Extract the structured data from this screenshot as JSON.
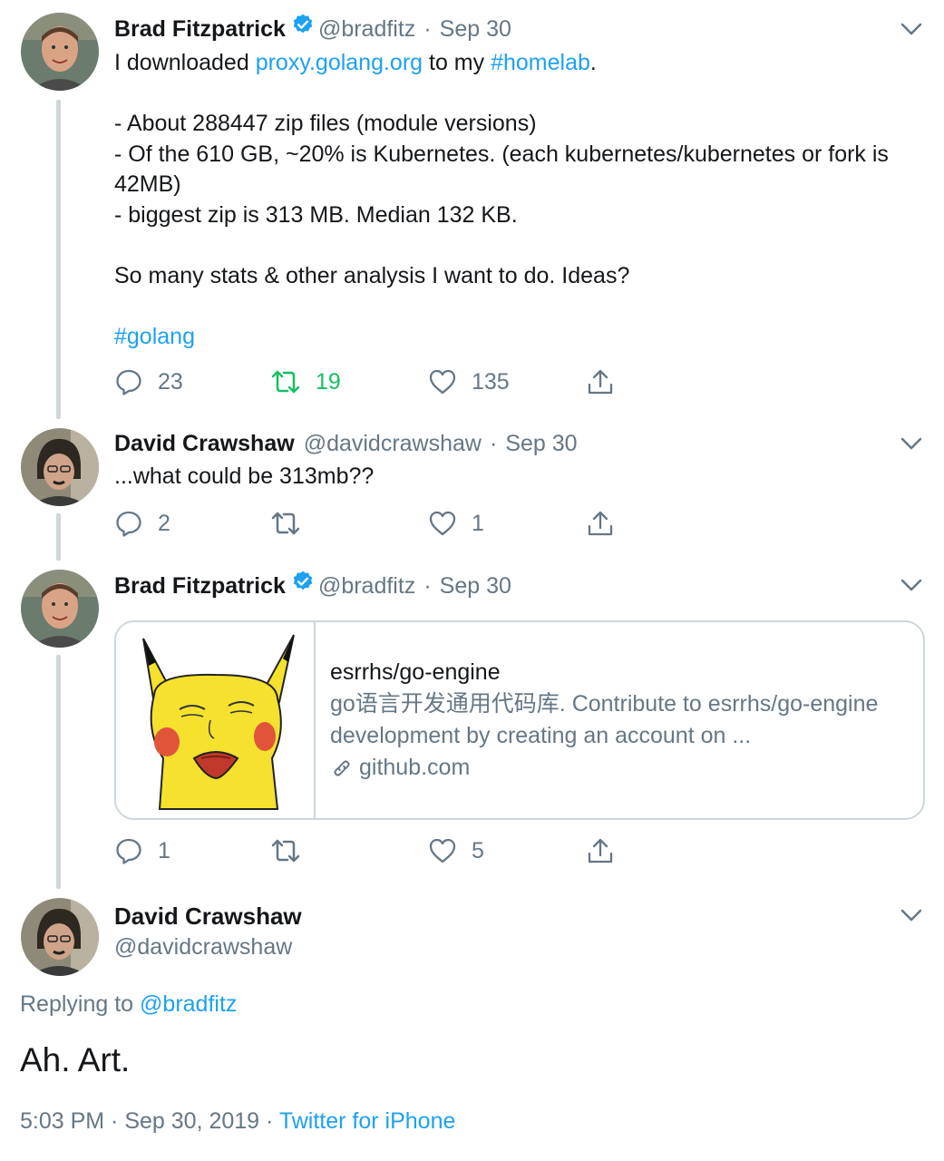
{
  "tweets": [
    {
      "name": "Brad Fitzpatrick",
      "handle": "@bradfitz",
      "dot": "·",
      "date": "Sep 30",
      "verified": true,
      "text": {
        "t1": "I downloaded ",
        "link1": "proxy.golang.org",
        "t2": " to my ",
        "hashtag1": "#homelab",
        "t3": ".",
        "line1": "- About 288447 zip files (module versions)",
        "line2": "- Of the 610 GB, ~20% is Kubernetes. (each kubernetes/kubernetes or fork is 42MB)",
        "line3": "- biggest zip is 313 MB. Median 132 KB.",
        "line4": "So many stats & other analysis I want to do. Ideas?",
        "hashtag2": "#golang"
      },
      "replies": "23",
      "retweets": "19",
      "likes": "135"
    },
    {
      "name": "David Crawshaw",
      "handle": "@davidcrawshaw",
      "dot": "·",
      "date": "Sep 30",
      "text": "...what could be 313mb??",
      "replies": "2",
      "retweets": "",
      "likes": "1"
    },
    {
      "name": "Brad Fitzpatrick",
      "handle": "@bradfitz",
      "dot": "·",
      "date": "Sep 30",
      "verified": true,
      "card": {
        "title": "esrrhs/go-engine",
        "description": "go语言开发通用代码库. Contribute to esrrhs/go-engine development by creating an account on ...",
        "domain": "github.com"
      },
      "replies": "1",
      "retweets": "",
      "likes": "5"
    }
  ],
  "main_tweet": {
    "name": "David Crawshaw",
    "handle": "@davidcrawshaw",
    "replying_prefix": "Replying to ",
    "replying_to": "@bradfitz",
    "text": "Ah. Art.",
    "time": "5:03 PM",
    "sep": " · ",
    "date": "Sep 30, 2019",
    "source": "Twitter for iPhone"
  },
  "colors": {
    "accent": "#1da1f2",
    "retweet_active": "#17bf63",
    "muted": "#657786",
    "thread_line": "#ccd6dd"
  },
  "icons": [
    "reply-icon",
    "retweet-icon",
    "like-icon",
    "share-icon",
    "chevron-down-icon",
    "verified-badge-icon",
    "link-icon"
  ]
}
